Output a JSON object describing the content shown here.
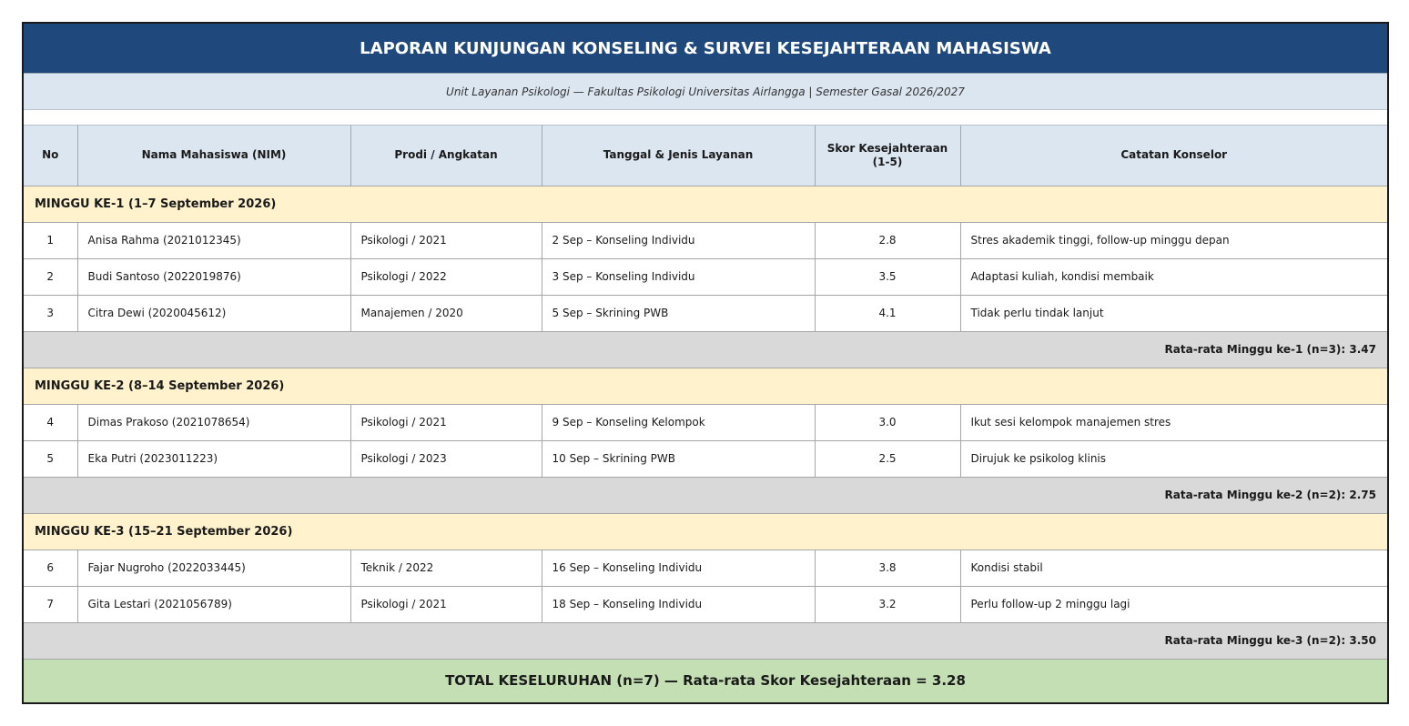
{
  "report": {
    "title": "LAPORAN KUNJUNGAN KONSELING & SURVEI KESEJAHTERAAN MAHASISWA",
    "subtitle": "Unit Layanan Psikologi — Fakultas Psikologi Universitas Airlangga | Semester Gasal 2026/2027"
  },
  "columns": {
    "no": "No",
    "name": "Nama Mahasiswa (NIM)",
    "prodi": "Prodi / Angkatan",
    "service": "Tanggal & Jenis Layanan",
    "score_line1": "Skor Kesejahteraan",
    "score_line2": "(1-5)",
    "notes": "Catatan Konselor"
  },
  "weeks": [
    {
      "label": "MINGGU KE-1 (1–7 September 2026)",
      "rows": [
        {
          "no": "1",
          "name": "Anisa Rahma (2021012345)",
          "prodi": "Psikologi / 2021",
          "service": "2 Sep – Konseling Individu",
          "score": "2.8",
          "notes": "Stres akademik tinggi, follow-up minggu depan"
        },
        {
          "no": "2",
          "name": "Budi Santoso (2022019876)",
          "prodi": "Psikologi / 2022",
          "service": "3 Sep – Konseling Individu",
          "score": "3.5",
          "notes": "Adaptasi kuliah, kondisi membaik"
        },
        {
          "no": "3",
          "name": "Citra Dewi (2020045612)",
          "prodi": "Manajemen / 2020",
          "service": "5 Sep – Skrining PWB",
          "score": "4.1",
          "notes": "Tidak perlu tindak lanjut"
        }
      ],
      "average": "Rata-rata Minggu ke-1 (n=3): 3.47"
    },
    {
      "label": "MINGGU KE-2 (8–14 September 2026)",
      "rows": [
        {
          "no": "4",
          "name": "Dimas Prakoso (2021078654)",
          "prodi": "Psikologi / 2021",
          "service": "9 Sep – Konseling Kelompok",
          "score": "3.0",
          "notes": "Ikut sesi kelompok manajemen stres"
        },
        {
          "no": "5",
          "name": "Eka Putri (2023011223)",
          "prodi": "Psikologi / 2023",
          "service": "10 Sep – Skrining PWB",
          "score": "2.5",
          "notes": "Dirujuk ke psikolog klinis"
        }
      ],
      "average": "Rata-rata Minggu ke-2 (n=2): 2.75"
    },
    {
      "label": "MINGGU KE-3 (15–21 September 2026)",
      "rows": [
        {
          "no": "6",
          "name": "Fajar Nugroho (2022033445)",
          "prodi": "Teknik / 2022",
          "service": "16 Sep – Konseling Individu",
          "score": "3.8",
          "notes": "Kondisi stabil"
        },
        {
          "no": "7",
          "name": "Gita Lestari (2021056789)",
          "prodi": "Psikologi / 2021",
          "service": "18 Sep – Konseling Individu",
          "score": "3.2",
          "notes": "Perlu follow-up 2 minggu lagi"
        }
      ],
      "average": "Rata-rata Minggu ke-3 (n=2): 3.50"
    }
  ],
  "total": "TOTAL KESELURUHAN (n=7) — Rata-rata Skor Kesejahteraan = 3.28",
  "colors": {
    "title_bg": "#1f497d",
    "header_bg": "#dce6f1",
    "week_bg": "#fff2cc",
    "average_bg": "#d9d9d9",
    "total_bg": "#c4dfb3"
  }
}
